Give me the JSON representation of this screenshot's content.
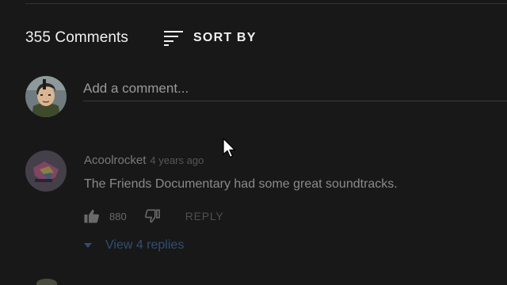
{
  "comments_section": {
    "count_label": "355 Comments",
    "sort_label": "SORT BY"
  },
  "add_comment": {
    "placeholder": "Add a comment..."
  },
  "comments": [
    {
      "author": "Acoolrocket",
      "time": "4 years ago",
      "text": "The Friends Documentary had some great soundtracks.",
      "likes": "880",
      "reply_label": "REPLY",
      "view_replies_label": "View 4 replies"
    }
  ],
  "icons": {
    "sort": "sort-icon",
    "like": "thumbs-up-icon",
    "dislike": "thumbs-down-icon",
    "expand": "chevron-down-icon",
    "cursor": "mouse-pointer-icon"
  },
  "colors": {
    "background": "#181818",
    "primary_text": "#f1f1f1",
    "muted_text": "#8a8a8a",
    "link_blue": "#2f4f73"
  }
}
